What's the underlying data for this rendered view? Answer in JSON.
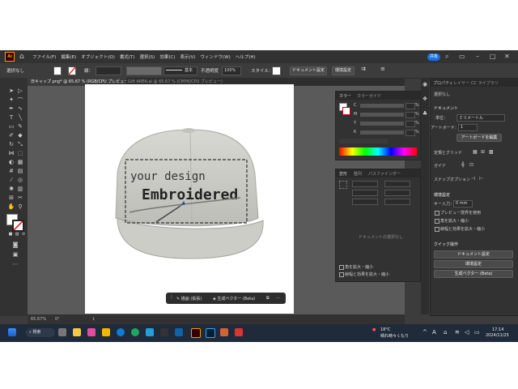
{
  "menubar": {
    "logo": "Ai",
    "items": [
      "ファイル(F)",
      "編集(E)",
      "オブジェクト(O)",
      "書式(T)",
      "選択(S)",
      "効果(C)",
      "表示(V)",
      "ウィンドウ(W)",
      "ヘルプ(H)"
    ],
    "share": "共有"
  },
  "controlbar": {
    "selection": "選択なし",
    "stroke_label": "線：",
    "stroke_style": "基本",
    "opacity_label": "不透明度",
    "opacity_value": "100%",
    "style_label": "スタイル：",
    "doc_setup": "ドキュメント設定",
    "prefs": "環境設定"
  },
  "tabs": [
    {
      "label": "日キャップ.png* @ 65.67 % (RGB/CPU プレビュー)",
      "active": true
    },
    {
      "label": "Gift AREA.ai @ 65.67 % (CMYK/CPU プレビュー)",
      "active": false
    }
  ],
  "artwork": {
    "text_line1": "your design",
    "text_line2": "Embroidered"
  },
  "contextbar": {
    "item1": "描画 (拡張)",
    "item2": "生成ベクター (Beta)"
  },
  "status": {
    "zoom": "65.67%",
    "angle": "0°",
    "page": "1"
  },
  "color_panel": {
    "tabs": [
      "カラー",
      "カラーガイド"
    ],
    "channels": [
      "C",
      "M",
      "Y",
      "K"
    ],
    "pct": "%"
  },
  "transform_panel": {
    "tabs": [
      "変形",
      "整列",
      "パスファインダー"
    ],
    "no_selection": "ドキュメントの選択なし",
    "options": [
      "角を拡大・縮小",
      "線幅と効果を拡大・縮小"
    ]
  },
  "properties_panel": {
    "tabs": [
      "プロパティ",
      "レイヤー",
      "CC ライブラリ"
    ],
    "no_selection": "選択なし",
    "document": "ドキュメント",
    "unit_label": "単位：",
    "unit_value": "ミリメートル",
    "artboard_label": "アートボード：",
    "artboard_value": "1",
    "edit_artboard": "アートボードを編集",
    "rulers_grid": "定規とグリッド",
    "guides": "ガイド",
    "snap_options": "スナップオプション",
    "prefs_header": "環境設定",
    "key_input_label": "キー入力：",
    "key_input_value": "0 mm",
    "checks": [
      "プレビュー境界を使用",
      "角を拡大・縮小",
      "線幅と効果を拡大・縮小"
    ],
    "quick_actions": "クイック操作",
    "qa_buttons": [
      "ドキュメント設定",
      "環境設定",
      "生成ベクター (Beta)"
    ]
  },
  "taskbar": {
    "search": "検索",
    "weather_temp": "18°C",
    "weather_desc": "晴れ時々くもり",
    "time": "17:14",
    "date": "2024/11/25"
  },
  "colors": {
    "accent": "#1473e6",
    "ai_orange": "#ff9a00"
  }
}
